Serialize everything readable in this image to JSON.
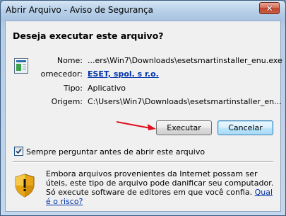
{
  "window": {
    "title": "Abrir Arquivo - Aviso de Segurança",
    "close_glyph": "✕"
  },
  "dialog": {
    "heading": "Deseja executar este arquivo?",
    "fields": {
      "name_label": "Nome:",
      "name_value": "...ers\\Win7\\Downloads\\esetsmartinstaller_enu.exe",
      "publisher_label": "ornecedor:",
      "publisher_value": "ESET, spol. s r.o.",
      "type_label": "Tipo:",
      "type_value": "Aplicativo",
      "origin_label": "Origem:",
      "origin_value": "C:\\Users\\Win7\\Downloads\\esetsmartinstaller_en..."
    },
    "buttons": {
      "run": "Executar",
      "cancel": "Cancelar"
    },
    "checkbox": {
      "label": "Sempre perguntar antes de abrir este arquivo",
      "checked": true
    },
    "warning": {
      "text": "Embora arquivos provenientes da Internet possam ser úteis, este tipo de arquivo pode danificar seu computador. Só execute software de editores em que você confia.",
      "link": "Qual é o risco?"
    }
  },
  "icons": {
    "file": "application-file-icon",
    "shield": "security-shield-icon",
    "arrow": "red-arrow-annotation"
  },
  "colors": {
    "link": "#0033aa",
    "arrow": "#e01020",
    "close": "#c0452f"
  }
}
